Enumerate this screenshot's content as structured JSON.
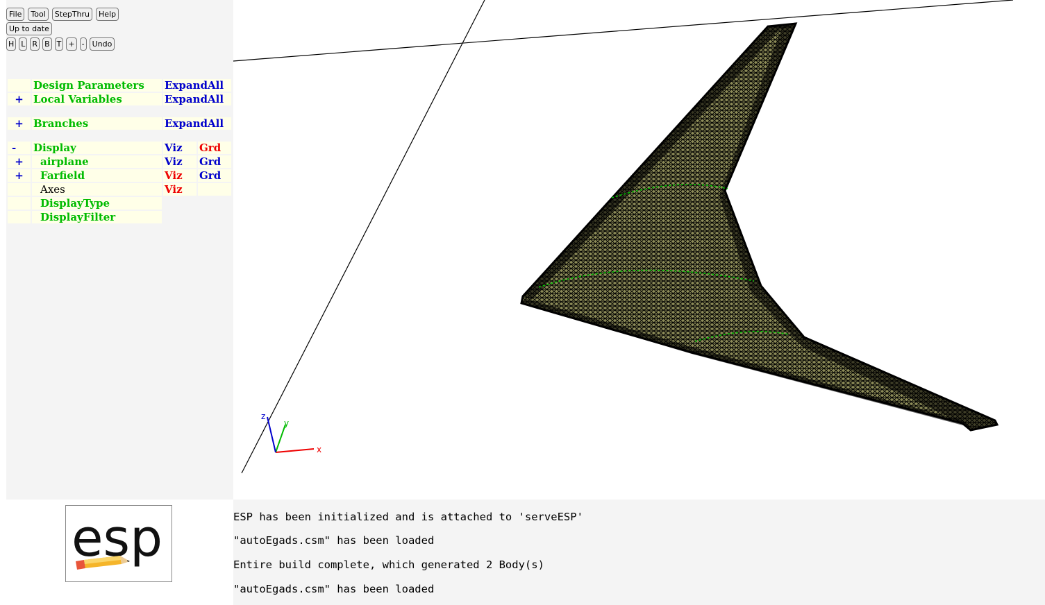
{
  "toolbar": {
    "file": "File",
    "tool": "Tool",
    "stepthru": "StepThru",
    "help": "Help",
    "status": "Up to date",
    "views": [
      "H",
      "L",
      "R",
      "B",
      "T",
      "+",
      "-"
    ],
    "undo": "Undo"
  },
  "tree": {
    "design_parameters": {
      "label": "Design Parameters",
      "action": "ExpandAll"
    },
    "local_variables": {
      "toggle": "+",
      "label": "Local Variables",
      "action": "ExpandAll"
    },
    "branches": {
      "toggle": "+",
      "label": "Branches",
      "action": "ExpandAll"
    },
    "display": {
      "toggle": "-",
      "label": "Display",
      "viz": "Viz",
      "grd": "Grd"
    },
    "airplane": {
      "toggle": "+",
      "label": "airplane",
      "viz": "Viz",
      "grd": "Grd"
    },
    "farfield": {
      "toggle": "+",
      "label": "Farfield",
      "viz": "Viz",
      "grd": "Grd"
    },
    "axes": {
      "label": "Axes",
      "viz": "Viz"
    },
    "display_type": {
      "label": "DisplayType"
    },
    "display_filter": {
      "label": "DisplayFilter"
    }
  },
  "colors": {
    "tree_label": "#00bb00",
    "link_blue": "#0000cc",
    "active_red": "#ee0000",
    "mesh_fill": "#8c8b58",
    "mesh_edge": "#000000"
  },
  "axes_triad": {
    "x": "x",
    "y": "y",
    "z": "z"
  },
  "logo": {
    "text": "esp",
    "icon": "pencil-icon"
  },
  "messages": [
    "ESP has been initialized and is attached to 'serveESP'",
    "\"autoEgads.csm\" has been loaded",
    "Entire build complete, which generated 2 Body(s)",
    "\"autoEgads.csm\" has been loaded"
  ]
}
